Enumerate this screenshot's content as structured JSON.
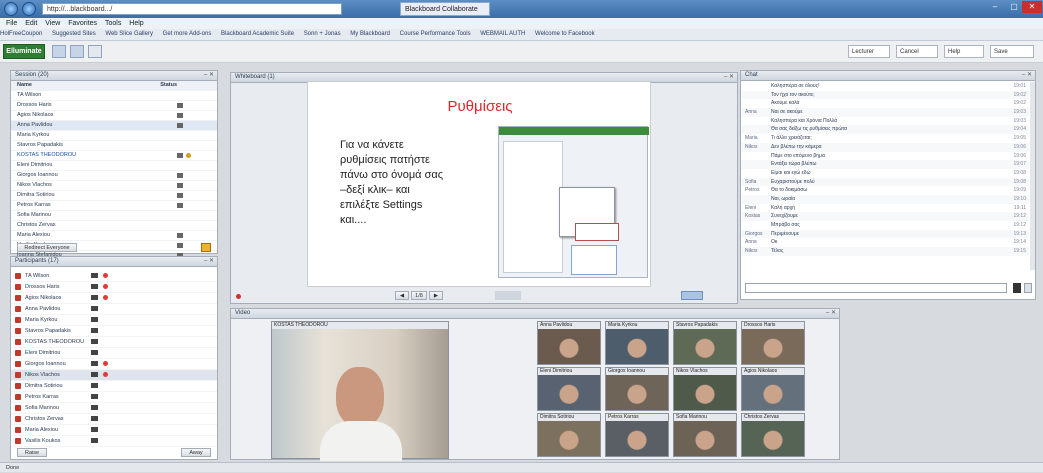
{
  "browser": {
    "address": "http://...blackboard.../",
    "tab_label": "Blackboard Collaborate",
    "win_controls": [
      "–",
      "▢",
      "✕"
    ],
    "menu": [
      "File",
      "Edit",
      "View",
      "Favorites",
      "Tools",
      "Help"
    ],
    "favorites": [
      "HolFreeCoupon",
      "Suggested Sites",
      "Web Slice Gallery",
      "Get more Add-ons",
      "Blackboard Academic Suite",
      "Sonn + Jonas",
      "My Blackboard",
      "Course Performance Tools",
      "WEBMAIL AUTH",
      "Welcome to Facebook"
    ]
  },
  "app": {
    "logo": "Elluminate",
    "right_controls": [
      "Lecturer",
      "Cancel",
      "Help",
      "Save"
    ]
  },
  "participants_panel": {
    "title": "Session (20)",
    "col_name": "Name",
    "col_status": "Status",
    "rows": [
      {
        "name": "TA Wilson",
        "icon": false
      },
      {
        "name": "Drossos Haris",
        "icon": true
      },
      {
        "name": "Agios Nikolaos",
        "icon": true
      },
      {
        "name": "Anna Pavlidou",
        "icon": true,
        "selected": true
      },
      {
        "name": "Maria Kyrkou",
        "icon": false
      },
      {
        "name": "Stavros Papadakis",
        "icon": false
      },
      {
        "name": "KOSTAS THEODOROU",
        "icon": true,
        "blue": true
      },
      {
        "name": "Eleni Dimitriou",
        "icon": false
      },
      {
        "name": "Giorgos Ioannou",
        "icon": true
      },
      {
        "name": "Nikos Vlachos",
        "icon": true
      },
      {
        "name": "Dimitra Sotiriou",
        "icon": true
      },
      {
        "name": "Petros Karras",
        "icon": true
      },
      {
        "name": "Sofia Marinou",
        "icon": false
      },
      {
        "name": "Christos Zervas",
        "icon": false
      },
      {
        "name": "Maria Alexiou",
        "icon": true
      },
      {
        "name": "Vasilis Koukos",
        "icon": true
      },
      {
        "name": "Ioanna Stefanidou",
        "icon": true
      }
    ],
    "button": "Redirect Everyone"
  },
  "participants_video": {
    "title": "Participants (17)",
    "rows": [
      {
        "name": "TA Wilson",
        "mic": true
      },
      {
        "name": "Drossos Haris",
        "mic": true
      },
      {
        "name": "Agios Nikolaos",
        "mic": true
      },
      {
        "name": "Anna Pavlidou",
        "mic": false
      },
      {
        "name": "Maria Kyrkou",
        "mic": false
      },
      {
        "name": "Stavros Papadakis",
        "mic": false
      },
      {
        "name": "KOSTAS THEODOROU",
        "mic": false
      },
      {
        "name": "Eleni Dimitriou",
        "mic": false
      },
      {
        "name": "Giorgos Ioannou",
        "mic": true
      },
      {
        "name": "Nikos Vlachos",
        "mic": true,
        "selected": true
      },
      {
        "name": "Dimitra Sotiriou",
        "mic": false
      },
      {
        "name": "Petros Karras",
        "mic": false
      },
      {
        "name": "Sofia Marinou",
        "mic": false
      },
      {
        "name": "Christos Zervas",
        "mic": false
      },
      {
        "name": "Maria Alexiou",
        "mic": false
      },
      {
        "name": "Vasilis Koukos",
        "mic": false
      }
    ],
    "buttons": [
      "Raise",
      "Away"
    ]
  },
  "slide": {
    "panel_title": "Whiteboard (1)",
    "title": "Ρυθμίσεις",
    "text": "Για να κάνετε\nρυθμίσεις πατήστε\nπάνω στο όνομά σας\n–δεξί κλικ– και\nεπιλέξτε Settings\nκαι....",
    "nav": [
      "◀",
      "1/8",
      "▶"
    ]
  },
  "chat": {
    "panel_title": "Chat",
    "lines": [
      {
        "who": "",
        "msg": "Καλησπέρα σε όλους!",
        "tm": "19:01"
      },
      {
        "who": "",
        "msg": "Τον ήχο τον ακούτε;",
        "tm": "19:02"
      },
      {
        "who": "",
        "msg": "Ακούμε καλά",
        "tm": "19:02"
      },
      {
        "who": "Anna",
        "msg": "Ναι σε ακούμε",
        "tm": "19:03"
      },
      {
        "who": "",
        "msg": "Καλησπέρα και Χρόνια Πολλά",
        "tm": "19:03"
      },
      {
        "who": "",
        "msg": "Θα σας δείξω τις ρυθμίσεις πρώτα",
        "tm": "19:04"
      },
      {
        "who": "Maria",
        "msg": "Τι άλλο χρειάζεται;",
        "tm": "19:05"
      },
      {
        "who": "Nikos",
        "msg": "Δεν βλέπω την κάμερα",
        "tm": "19:06"
      },
      {
        "who": "",
        "msg": "Πάμε στο επόμενο βήμα",
        "tm": "19:06"
      },
      {
        "who": "",
        "msg": "Εντάξει τώρα βλέπω",
        "tm": "19:07"
      },
      {
        "who": "",
        "msg": "Είμαι και εγώ εδώ",
        "tm": "19:08"
      },
      {
        "who": "Sofia",
        "msg": "Ευχαριστούμε πολύ",
        "tm": "19:08"
      },
      {
        "who": "Petros",
        "msg": "Θα το δοκιμάσω",
        "tm": "19:09"
      },
      {
        "who": "",
        "msg": "Ναι, ωραία",
        "tm": "19:10"
      },
      {
        "who": "Eleni",
        "msg": "Καλή αρχή",
        "tm": "19:11"
      },
      {
        "who": "Kostas",
        "msg": "Συνεχίζουμε",
        "tm": "19:12"
      },
      {
        "who": "",
        "msg": "Μπράβο σας",
        "tm": "19:12"
      },
      {
        "who": "Giorgos",
        "msg": "Περιμένουμε",
        "tm": "19:13"
      },
      {
        "who": "Anna",
        "msg": "Οκ",
        "tm": "19:14"
      },
      {
        "who": "Nikos",
        "msg": "Τέλος",
        "tm": "19:15"
      }
    ]
  },
  "video": {
    "panel_title": "Video",
    "main_label": "KOSTAS THEODOROU",
    "thumbs": [
      "Anna Pavlidou",
      "Maria Kyrkou",
      "Stavros Papadakis",
      "Drossos Haris",
      "Eleni Dimitriou",
      "Giorgos Ioannou",
      "Nikos Vlachos",
      "Agios Nikolaos",
      "Dimitra Sotiriou",
      "Petros Karras",
      "Sofia Marinou",
      "Christos Zervas"
    ]
  },
  "statusbar": "Done"
}
